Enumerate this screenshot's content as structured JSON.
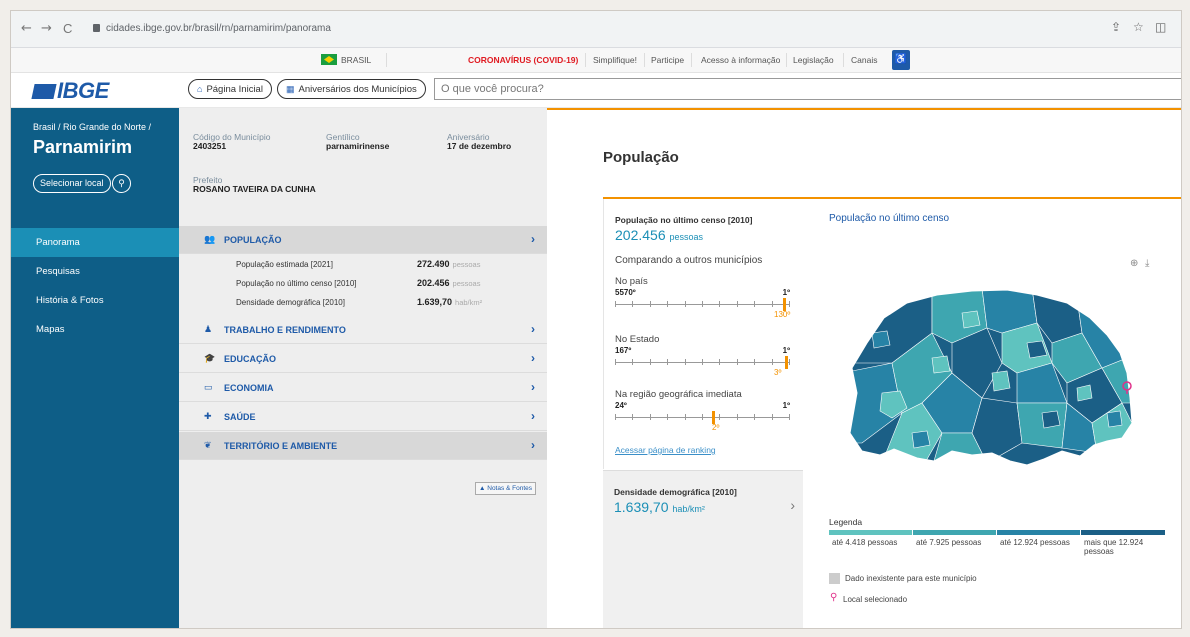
{
  "browser": {
    "url": "cidades.ibge.gov.br/brasil/rn/parnamirim/panorama",
    "back_icon": "←",
    "forward_icon": "→",
    "reload_icon": "C",
    "share_icon": "⇪",
    "star_icon": "☆",
    "window_icon": "◫"
  },
  "govbar": {
    "brasil": "BRASIL",
    "covid": "CORONAVÍRUS (COVID-19)",
    "links": [
      "Simplifique!",
      "Participe",
      "Acesso à informação",
      "Legislação",
      "Canais"
    ],
    "covid_color": "#e01b22"
  },
  "header": {
    "logo": "IBGE",
    "home": "Página Inicial",
    "anniversaries": "Aniversários dos Municípios",
    "search_placeholder": "O que você procura?"
  },
  "sidebar": {
    "breadcrumb": "Brasil / Rio Grande do Norte /",
    "city": "Parnamirim",
    "select_location": "Selecionar local",
    "menu": [
      "Panorama",
      "Pesquisas",
      "História & Fotos",
      "Mapas"
    ],
    "active_index": 0
  },
  "info": {
    "code_label": "Código do Município",
    "code_value": "2403251",
    "gentilic_label": "Gentílico",
    "gentilic_value": "parnamirinense",
    "anniversary_label": "Aniversário",
    "anniversary_value": "17 de dezembro",
    "mayor_label": "Prefeito",
    "mayor_value": "ROSANO TAVEIRA DA CUNHA"
  },
  "sections": [
    {
      "title": "População",
      "icon": "people-icon",
      "open": true,
      "rows": [
        {
          "label": "População estimada [2021]",
          "value": "272.490",
          "unit": "pessoas"
        },
        {
          "label": "População no último censo [2010]",
          "value": "202.456",
          "unit": "pessoas"
        },
        {
          "label": "Densidade demográfica [2010]",
          "value": "1.639,70",
          "unit": "hab/km²"
        }
      ]
    },
    {
      "title": "Trabalho e Rendimento",
      "icon": "worker-icon"
    },
    {
      "title": "Educação",
      "icon": "graduation-icon"
    },
    {
      "title": "Economia",
      "icon": "money-icon"
    },
    {
      "title": "Saúde",
      "icon": "health-icon"
    },
    {
      "title": "Território e Ambiente",
      "icon": "leaf-icon"
    }
  ],
  "notes": "Notas & Fontes",
  "main": {
    "title": "População",
    "card_title": "População no último censo [2010]",
    "card_value": "202.456",
    "card_unit": "pessoas",
    "compare": "Comparando a outros municípios",
    "rankings": [
      {
        "label": "No país",
        "min": "5570º",
        "max": "1º",
        "pos": "130º",
        "fraction": 0.977
      },
      {
        "label": "No Estado",
        "min": "167º",
        "max": "1º",
        "pos": "3º",
        "fraction": 0.988
      },
      {
        "label": "Na região geográfica imediata",
        "min": "24º",
        "max": "1º",
        "pos": "2º",
        "fraction": 0.565
      }
    ],
    "ranking_link": "Acessar página de ranking",
    "density_title": "Densidade demográfica [2010]",
    "density_value": "1.639,70",
    "density_unit": "hab/km²",
    "map_title": "População no último censo",
    "legend_title": "Legenda",
    "legend": [
      {
        "label": "até 4.418 pessoas",
        "color": "#5fc3bf"
      },
      {
        "label": "até 7.925 pessoas",
        "color": "#3ea6b0"
      },
      {
        "label": "até 12.924 pessoas",
        "color": "#2783a6"
      },
      {
        "label": "mais que 12.924 pessoas",
        "color": "#1b5f86"
      }
    ],
    "no_data": "Dado inexistente para este município",
    "selected": "Local selecionado",
    "accent": "#f39200"
  }
}
